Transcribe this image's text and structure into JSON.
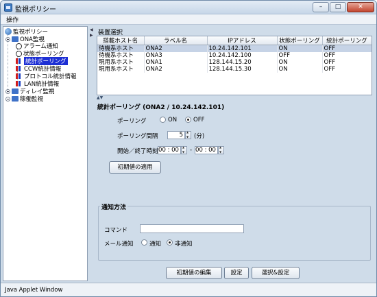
{
  "window": {
    "title": "監視ポリシー",
    "min": "–",
    "max": "□",
    "close": "✕"
  },
  "menubar": {
    "item": "操作"
  },
  "tree": {
    "root": "監視ポリシー",
    "ona": "ONA監視",
    "items": [
      "アラーム通知",
      "状態ポーリング",
      "統計ポーリング",
      "CCW統計情報",
      "プロトコル統計情報",
      "LAN統計情報"
    ],
    "delay": "ディレイ監視",
    "uptime": "稼働監視"
  },
  "devices": {
    "title": "装置選択",
    "columns": [
      "搭載ホスト名",
      "ラベル名",
      "IPアドレス",
      "状態ポーリング",
      "統計ポーリング"
    ],
    "rows": [
      [
        "待機系ホスト",
        "ONA2",
        "10.24.142.101",
        "ON",
        "OFF"
      ],
      [
        "待機系ホスト",
        "ONA3",
        "10.24.142.100",
        "OFF",
        "OFF"
      ],
      [
        "現用系ホスト",
        "ONA1",
        "128.144.15.20",
        "ON",
        "OFF"
      ],
      [
        "現用系ホスト",
        "ONA2",
        "128.144.15.30",
        "ON",
        "OFF"
      ]
    ],
    "selected_row": 0
  },
  "stats": {
    "title": "統計ポーリング (ONA2 / 10.24.142.101)",
    "polling_label": "ポーリング",
    "on_label": "ON",
    "off_label": "OFF",
    "polling_value": "OFF",
    "interval_label": "ポーリング間隔",
    "interval_value": "5",
    "interval_unit": "(分)",
    "time_label": "開始／終了時刻",
    "start_time": "00 : 00",
    "time_sep": "-",
    "end_time": "00 : 00",
    "apply_defaults": "初期値の適用"
  },
  "notify": {
    "title": "通知方法",
    "command_label": "コマンド",
    "command_value": "",
    "mail_label": "メール通知",
    "notify_label": "通知",
    "no_notify_label": "非通知",
    "mail_value": "非通知"
  },
  "buttons": {
    "edit_defaults": "初期値の編集",
    "set": "設定",
    "select_set": "選択&設定"
  },
  "status": {
    "text": "Java Applet Window"
  }
}
